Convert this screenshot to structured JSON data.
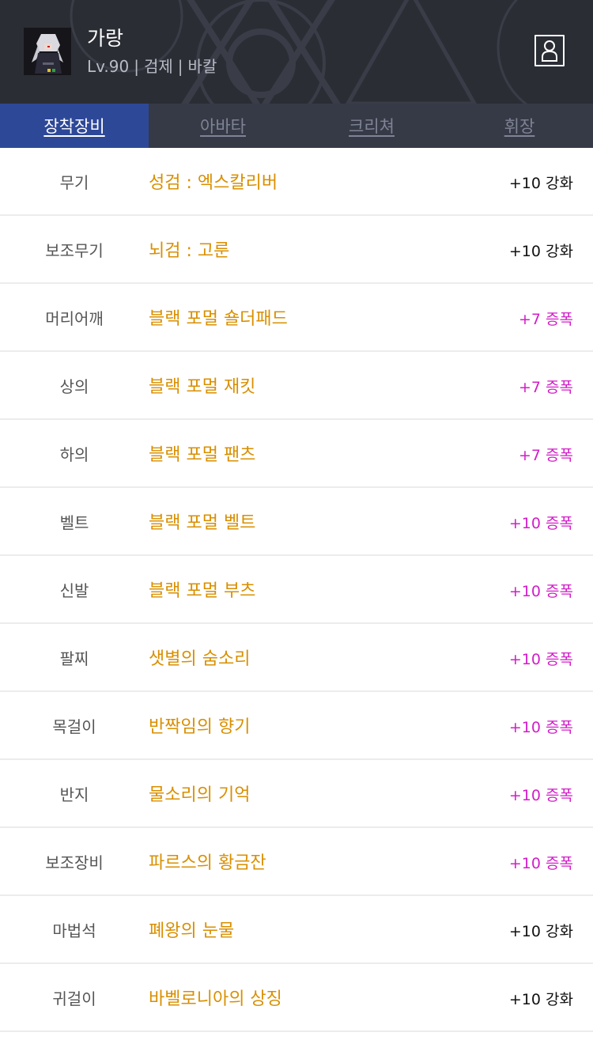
{
  "character": {
    "name": "가랑",
    "level": "Lv.90",
    "job": "검제",
    "server": "바칼",
    "separator": "|"
  },
  "header": {
    "profile_icon": "person-icon"
  },
  "tabs": [
    {
      "label": "장착장비",
      "active": true
    },
    {
      "label": "아바타",
      "active": false
    },
    {
      "label": "크리쳐",
      "active": false
    },
    {
      "label": "휘장",
      "active": false
    }
  ],
  "colors": {
    "header_bg": "#2b2d35",
    "tab_bg": "#363a46",
    "tab_active": "#2e4898",
    "item_name": "#d98f00",
    "amplify": "#d21ec8",
    "reinforce": "#111111"
  },
  "equipment": [
    {
      "slot": "무기",
      "name": "성검 : 엑스칼리버",
      "enhance": "+10 강화",
      "type": "reinforce"
    },
    {
      "slot": "보조무기",
      "name": "뇌검 : 고룬",
      "enhance": "+10 강화",
      "type": "reinforce"
    },
    {
      "slot": "머리어깨",
      "name": "블랙 포멀 숄더패드",
      "enhance": "+7 증폭",
      "type": "amplify"
    },
    {
      "slot": "상의",
      "name": "블랙 포멀 재킷",
      "enhance": "+7 증폭",
      "type": "amplify"
    },
    {
      "slot": "하의",
      "name": "블랙 포멀 팬츠",
      "enhance": "+7 증폭",
      "type": "amplify"
    },
    {
      "slot": "벨트",
      "name": "블랙 포멀 벨트",
      "enhance": "+10 증폭",
      "type": "amplify"
    },
    {
      "slot": "신발",
      "name": "블랙 포멀 부츠",
      "enhance": "+10 증폭",
      "type": "amplify"
    },
    {
      "slot": "팔찌",
      "name": "샛별의 숨소리",
      "enhance": "+10 증폭",
      "type": "amplify"
    },
    {
      "slot": "목걸이",
      "name": "반짝임의 향기",
      "enhance": "+10 증폭",
      "type": "amplify"
    },
    {
      "slot": "반지",
      "name": "물소리의 기억",
      "enhance": "+10 증폭",
      "type": "amplify"
    },
    {
      "slot": "보조장비",
      "name": "파르스의 황금잔",
      "enhance": "+10 증폭",
      "type": "amplify"
    },
    {
      "slot": "마법석",
      "name": "폐왕의 눈물",
      "enhance": "+10 강화",
      "type": "reinforce"
    },
    {
      "slot": "귀걸이",
      "name": "바벨로니아의 상징",
      "enhance": "+10 강화",
      "type": "reinforce"
    }
  ]
}
